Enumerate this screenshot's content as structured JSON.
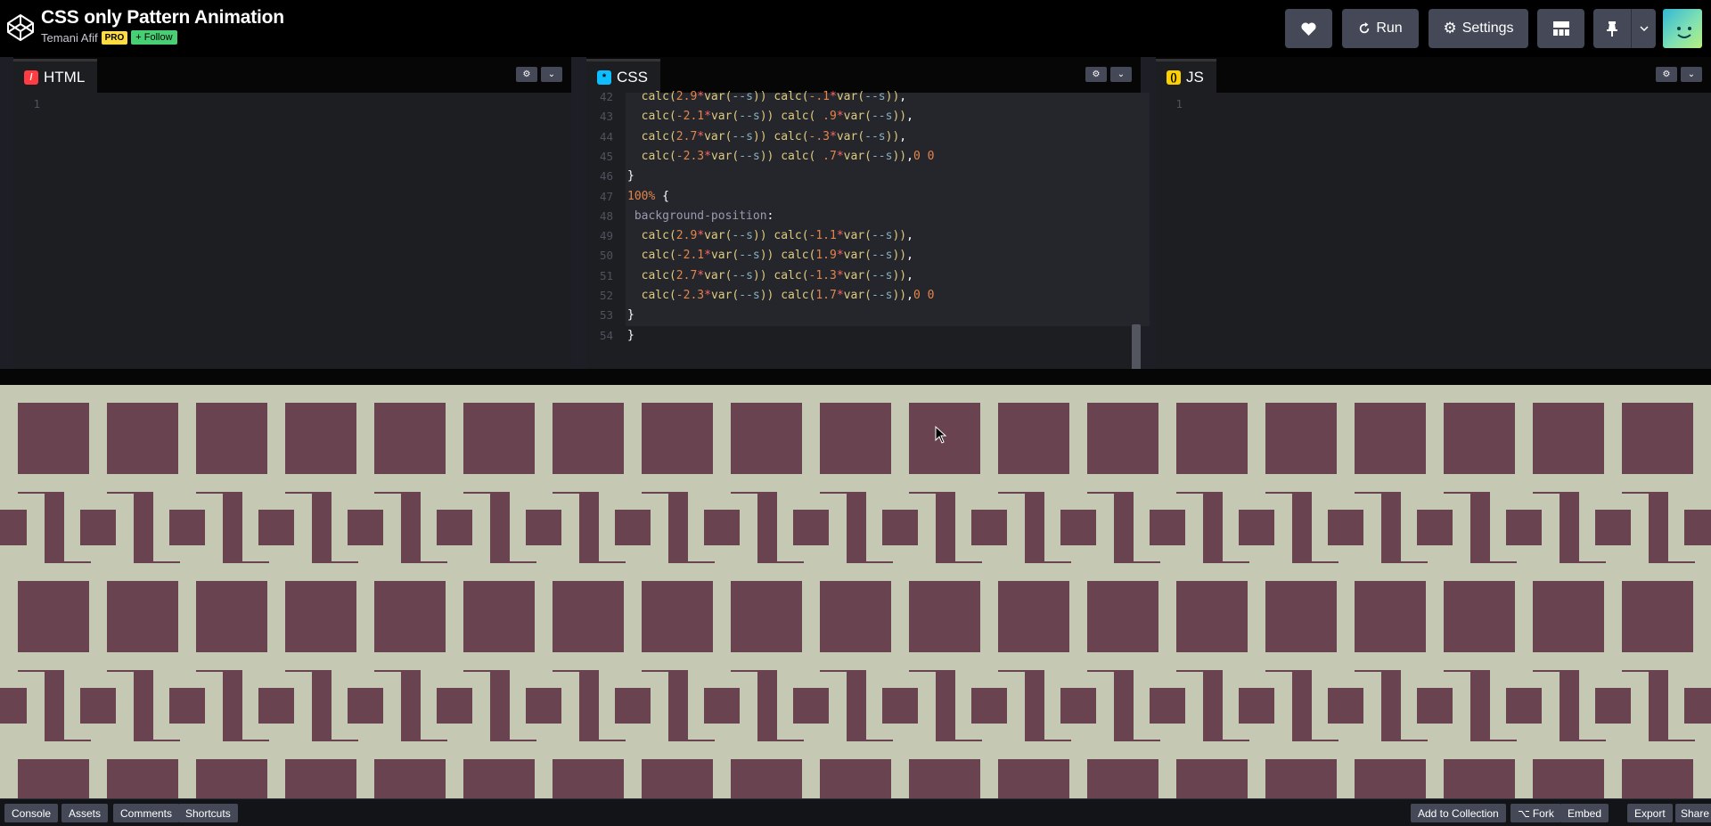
{
  "header": {
    "title": "CSS only Pattern Animation",
    "author": "Temani Afif",
    "pro_badge": "PRO",
    "follow_label": "+ Follow",
    "run_label": "Run",
    "settings_label": "Settings"
  },
  "editors": {
    "html": {
      "label": "HTML",
      "lines": [
        "1"
      ]
    },
    "css": {
      "label": "CSS",
      "code": [
        {
          "n": "42",
          "parts": [
            [
              "pl",
              "  "
            ],
            [
              "fn",
              "calc("
            ],
            [
              "num",
              "2.9"
            ],
            [
              "op",
              "*"
            ],
            [
              "fn",
              "var("
            ],
            [
              "var",
              "--s"
            ],
            [
              "fn",
              "))"
            ],
            [
              "pl",
              " "
            ],
            [
              "fn",
              "calc("
            ],
            [
              "num",
              "-.1"
            ],
            [
              "op",
              "*"
            ],
            [
              "fn",
              "var("
            ],
            [
              "var",
              "--s"
            ],
            [
              "fn",
              "))"
            ],
            [
              "pl",
              ","
            ]
          ]
        },
        {
          "n": "43",
          "parts": [
            [
              "pl",
              "  "
            ],
            [
              "fn",
              "calc("
            ],
            [
              "num",
              "-2.1"
            ],
            [
              "op",
              "*"
            ],
            [
              "fn",
              "var("
            ],
            [
              "var",
              "--s"
            ],
            [
              "fn",
              "))"
            ],
            [
              "pl",
              " "
            ],
            [
              "fn",
              "calc("
            ],
            [
              "num",
              " .9"
            ],
            [
              "op",
              "*"
            ],
            [
              "fn",
              "var("
            ],
            [
              "var",
              "--s"
            ],
            [
              "fn",
              "))"
            ],
            [
              "pl",
              ","
            ]
          ]
        },
        {
          "n": "44",
          "parts": [
            [
              "pl",
              "  "
            ],
            [
              "fn",
              "calc("
            ],
            [
              "num",
              "2.7"
            ],
            [
              "op",
              "*"
            ],
            [
              "fn",
              "var("
            ],
            [
              "var",
              "--s"
            ],
            [
              "fn",
              "))"
            ],
            [
              "pl",
              " "
            ],
            [
              "fn",
              "calc("
            ],
            [
              "num",
              "-.3"
            ],
            [
              "op",
              "*"
            ],
            [
              "fn",
              "var("
            ],
            [
              "var",
              "--s"
            ],
            [
              "fn",
              "))"
            ],
            [
              "pl",
              ","
            ]
          ]
        },
        {
          "n": "45",
          "parts": [
            [
              "pl",
              "  "
            ],
            [
              "fn",
              "calc("
            ],
            [
              "num",
              "-2.3"
            ],
            [
              "op",
              "*"
            ],
            [
              "fn",
              "var("
            ],
            [
              "var",
              "--s"
            ],
            [
              "fn",
              "))"
            ],
            [
              "pl",
              " "
            ],
            [
              "fn",
              "calc("
            ],
            [
              "num",
              " .7"
            ],
            [
              "op",
              "*"
            ],
            [
              "fn",
              "var("
            ],
            [
              "var",
              "--s"
            ],
            [
              "fn",
              "))"
            ],
            [
              "pl",
              ","
            ],
            [
              "num",
              "0 0"
            ]
          ]
        },
        {
          "n": "46",
          "parts": [
            [
              "pl",
              "}"
            ]
          ]
        },
        {
          "n": "47",
          "parts": [
            [
              "sel",
              "100%"
            ],
            [
              "pl",
              " {"
            ]
          ]
        },
        {
          "n": "48",
          "parts": [
            [
              "prop",
              " background-position"
            ],
            [
              "pl",
              ":"
            ]
          ]
        },
        {
          "n": "49",
          "parts": [
            [
              "pl",
              "  "
            ],
            [
              "fn",
              "calc("
            ],
            [
              "num",
              "2.9"
            ],
            [
              "op",
              "*"
            ],
            [
              "fn",
              "var("
            ],
            [
              "var",
              "--s"
            ],
            [
              "fn",
              "))"
            ],
            [
              "pl",
              " "
            ],
            [
              "fn",
              "calc("
            ],
            [
              "num",
              "-1.1"
            ],
            [
              "op",
              "*"
            ],
            [
              "fn",
              "var("
            ],
            [
              "var",
              "--s"
            ],
            [
              "fn",
              "))"
            ],
            [
              "pl",
              ","
            ]
          ]
        },
        {
          "n": "50",
          "parts": [
            [
              "pl",
              "  "
            ],
            [
              "fn",
              "calc("
            ],
            [
              "num",
              "-2.1"
            ],
            [
              "op",
              "*"
            ],
            [
              "fn",
              "var("
            ],
            [
              "var",
              "--s"
            ],
            [
              "fn",
              "))"
            ],
            [
              "pl",
              " "
            ],
            [
              "fn",
              "calc("
            ],
            [
              "num",
              "1.9"
            ],
            [
              "op",
              "*"
            ],
            [
              "fn",
              "var("
            ],
            [
              "var",
              "--s"
            ],
            [
              "fn",
              "))"
            ],
            [
              "pl",
              ","
            ]
          ]
        },
        {
          "n": "51",
          "parts": [
            [
              "pl",
              "  "
            ],
            [
              "fn",
              "calc("
            ],
            [
              "num",
              "2.7"
            ],
            [
              "op",
              "*"
            ],
            [
              "fn",
              "var("
            ],
            [
              "var",
              "--s"
            ],
            [
              "fn",
              "))"
            ],
            [
              "pl",
              " "
            ],
            [
              "fn",
              "calc("
            ],
            [
              "num",
              "-1.3"
            ],
            [
              "op",
              "*"
            ],
            [
              "fn",
              "var("
            ],
            [
              "var",
              "--s"
            ],
            [
              "fn",
              "))"
            ],
            [
              "pl",
              ","
            ]
          ]
        },
        {
          "n": "52",
          "parts": [
            [
              "pl",
              "  "
            ],
            [
              "fn",
              "calc("
            ],
            [
              "num",
              "-2.3"
            ],
            [
              "op",
              "*"
            ],
            [
              "fn",
              "var("
            ],
            [
              "var",
              "--s"
            ],
            [
              "fn",
              "))"
            ],
            [
              "pl",
              " "
            ],
            [
              "fn",
              "calc("
            ],
            [
              "num",
              "1.7"
            ],
            [
              "op",
              "*"
            ],
            [
              "fn",
              "var("
            ],
            [
              "var",
              "--s"
            ],
            [
              "fn",
              "))"
            ],
            [
              "pl",
              ","
            ],
            [
              "num",
              "0 0"
            ]
          ]
        },
        {
          "n": "53",
          "parts": [
            [
              "pl",
              "}"
            ]
          ]
        },
        {
          "n": "54",
          "parts": [
            [
              "pl",
              "}"
            ]
          ]
        }
      ]
    },
    "js": {
      "label": "JS",
      "lines": [
        "1"
      ]
    }
  },
  "preview": {
    "bg_color": "#c5c9b3",
    "shape_color": "#6a4351"
  },
  "footer": {
    "console": "Console",
    "assets": "Assets",
    "comments": "Comments",
    "shortcuts": "Shortcuts",
    "add_to_collection": "Add to Collection",
    "fork": "Fork",
    "embed": "Embed",
    "export": "Export",
    "share": "Share"
  },
  "colors": {
    "html_icon": "#ff3c41",
    "css_icon": "#0ebeff",
    "js_icon": "#fcd000",
    "button": "#444857"
  }
}
